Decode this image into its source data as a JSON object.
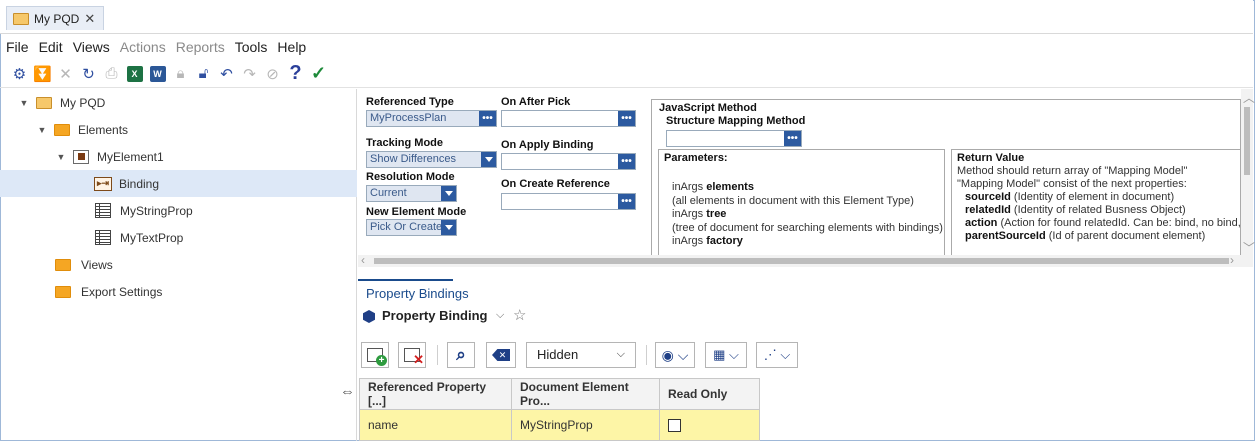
{
  "tab": {
    "title": "My PQD",
    "close": "✕"
  },
  "menu": [
    {
      "label": "File",
      "disabled": false
    },
    {
      "label": "Edit",
      "disabled": false
    },
    {
      "label": "Views",
      "disabled": false
    },
    {
      "label": "Actions",
      "disabled": true
    },
    {
      "label": "Reports",
      "disabled": true
    },
    {
      "label": "Tools",
      "disabled": false
    },
    {
      "label": "Help",
      "disabled": false
    }
  ],
  "toolbar": {
    "icons": [
      "settings-icon",
      "download-icon",
      "close-icon",
      "refresh-icon",
      "print-icon",
      "excel-icon",
      "word-icon",
      "lock-icon",
      "unlock-icon",
      "undo-icon",
      "redo-icon",
      "check-disabled-icon",
      "help-icon",
      "apply-check-icon"
    ],
    "excel_label": "X",
    "word_label": "W",
    "help_label": "?"
  },
  "tree": {
    "root": "My PQD",
    "elements": "Elements",
    "element1": "MyElement1",
    "binding": "Binding",
    "string_prop": "MyStringProp",
    "text_prop": "MyTextProp",
    "views": "Views",
    "export_settings": "Export Settings"
  },
  "editor": {
    "referenced_type_label": "Referenced Type",
    "referenced_type_value": "MyProcessPlan",
    "on_after_pick_label": "On After Pick",
    "tracking_mode_label": "Tracking Mode",
    "tracking_mode_value": "Show Differences",
    "on_apply_binding_label": "On Apply Binding",
    "resolution_mode_label": "Resolution Mode",
    "resolution_mode_value": "Current",
    "on_create_reference_label": "On Create Reference",
    "new_element_mode_label": "New Element Mode",
    "new_element_mode_value": "Pick Or Create",
    "ellipsis": "•••"
  },
  "js": {
    "title": "JavaScript Method",
    "subtitle": "Structure Mapping Method",
    "parameters_title": "Parameters:",
    "return_title": "Return Value",
    "params": {
      "l1_pre": "inArgs ",
      "l1_b": "elements",
      "l2": "(all elements in document with this Element Type)",
      "l3_pre": "inArgs ",
      "l3_b": "tree",
      "l4": "(tree of document for searching elements with bindings)",
      "l5_pre": "inArgs ",
      "l5_b": "factory"
    },
    "ret": {
      "l1": "Method should return array of \"Mapping Model\"",
      "l2": "\"Mapping Model\" consist of the next properties:",
      "l3_b": "sourceId",
      "l3": " (Identity of element in document)",
      "l4_b": "relatedId",
      "l4": " (Identity of related Busness Object)",
      "l5_b": "action",
      "l5": " (Action for found relatedId. Can be: bind, no bind, ig",
      "l6_b": "parentSourceId",
      "l6": " (Id of parent document element)"
    }
  },
  "bindings": {
    "tab_title": "Property Bindings",
    "subtitle": "Property Binding",
    "hidden_select": "Hidden",
    "columns": [
      "Referenced Property [...]",
      "Document Element Pro...",
      "Read Only"
    ],
    "rows": [
      {
        "referenced_property": "name",
        "document_element_property": "MyStringProp",
        "read_only": false
      }
    ]
  }
}
